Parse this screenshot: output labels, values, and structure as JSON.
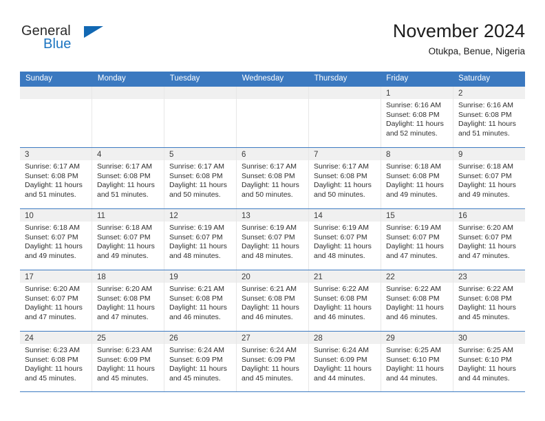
{
  "brand": {
    "word1": "General",
    "word2": "Blue",
    "accent_color": "#1268b3"
  },
  "header": {
    "title": "November 2024",
    "location": "Otukpa, Benue, Nigeria"
  },
  "theme": {
    "header_bar": "#3b79c0",
    "day_number_band": "#f0f0f0",
    "cell_divider": "#e7e7e7"
  },
  "weekday_headers": [
    "Sunday",
    "Monday",
    "Tuesday",
    "Wednesday",
    "Thursday",
    "Friday",
    "Saturday"
  ],
  "weeks": [
    [
      {
        "day": "",
        "sunrise": "",
        "sunset": "",
        "daylight1": "",
        "daylight2": ""
      },
      {
        "day": "",
        "sunrise": "",
        "sunset": "",
        "daylight1": "",
        "daylight2": ""
      },
      {
        "day": "",
        "sunrise": "",
        "sunset": "",
        "daylight1": "",
        "daylight2": ""
      },
      {
        "day": "",
        "sunrise": "",
        "sunset": "",
        "daylight1": "",
        "daylight2": ""
      },
      {
        "day": "",
        "sunrise": "",
        "sunset": "",
        "daylight1": "",
        "daylight2": ""
      },
      {
        "day": "1",
        "sunrise": "Sunrise: 6:16 AM",
        "sunset": "Sunset: 6:08 PM",
        "daylight1": "Daylight: 11 hours",
        "daylight2": "and 52 minutes."
      },
      {
        "day": "2",
        "sunrise": "Sunrise: 6:16 AM",
        "sunset": "Sunset: 6:08 PM",
        "daylight1": "Daylight: 11 hours",
        "daylight2": "and 51 minutes."
      }
    ],
    [
      {
        "day": "3",
        "sunrise": "Sunrise: 6:17 AM",
        "sunset": "Sunset: 6:08 PM",
        "daylight1": "Daylight: 11 hours",
        "daylight2": "and 51 minutes."
      },
      {
        "day": "4",
        "sunrise": "Sunrise: 6:17 AM",
        "sunset": "Sunset: 6:08 PM",
        "daylight1": "Daylight: 11 hours",
        "daylight2": "and 51 minutes."
      },
      {
        "day": "5",
        "sunrise": "Sunrise: 6:17 AM",
        "sunset": "Sunset: 6:08 PM",
        "daylight1": "Daylight: 11 hours",
        "daylight2": "and 50 minutes."
      },
      {
        "day": "6",
        "sunrise": "Sunrise: 6:17 AM",
        "sunset": "Sunset: 6:08 PM",
        "daylight1": "Daylight: 11 hours",
        "daylight2": "and 50 minutes."
      },
      {
        "day": "7",
        "sunrise": "Sunrise: 6:17 AM",
        "sunset": "Sunset: 6:08 PM",
        "daylight1": "Daylight: 11 hours",
        "daylight2": "and 50 minutes."
      },
      {
        "day": "8",
        "sunrise": "Sunrise: 6:18 AM",
        "sunset": "Sunset: 6:08 PM",
        "daylight1": "Daylight: 11 hours",
        "daylight2": "and 49 minutes."
      },
      {
        "day": "9",
        "sunrise": "Sunrise: 6:18 AM",
        "sunset": "Sunset: 6:07 PM",
        "daylight1": "Daylight: 11 hours",
        "daylight2": "and 49 minutes."
      }
    ],
    [
      {
        "day": "10",
        "sunrise": "Sunrise: 6:18 AM",
        "sunset": "Sunset: 6:07 PM",
        "daylight1": "Daylight: 11 hours",
        "daylight2": "and 49 minutes."
      },
      {
        "day": "11",
        "sunrise": "Sunrise: 6:18 AM",
        "sunset": "Sunset: 6:07 PM",
        "daylight1": "Daylight: 11 hours",
        "daylight2": "and 49 minutes."
      },
      {
        "day": "12",
        "sunrise": "Sunrise: 6:19 AM",
        "sunset": "Sunset: 6:07 PM",
        "daylight1": "Daylight: 11 hours",
        "daylight2": "and 48 minutes."
      },
      {
        "day": "13",
        "sunrise": "Sunrise: 6:19 AM",
        "sunset": "Sunset: 6:07 PM",
        "daylight1": "Daylight: 11 hours",
        "daylight2": "and 48 minutes."
      },
      {
        "day": "14",
        "sunrise": "Sunrise: 6:19 AM",
        "sunset": "Sunset: 6:07 PM",
        "daylight1": "Daylight: 11 hours",
        "daylight2": "and 48 minutes."
      },
      {
        "day": "15",
        "sunrise": "Sunrise: 6:19 AM",
        "sunset": "Sunset: 6:07 PM",
        "daylight1": "Daylight: 11 hours",
        "daylight2": "and 47 minutes."
      },
      {
        "day": "16",
        "sunrise": "Sunrise: 6:20 AM",
        "sunset": "Sunset: 6:07 PM",
        "daylight1": "Daylight: 11 hours",
        "daylight2": "and 47 minutes."
      }
    ],
    [
      {
        "day": "17",
        "sunrise": "Sunrise: 6:20 AM",
        "sunset": "Sunset: 6:07 PM",
        "daylight1": "Daylight: 11 hours",
        "daylight2": "and 47 minutes."
      },
      {
        "day": "18",
        "sunrise": "Sunrise: 6:20 AM",
        "sunset": "Sunset: 6:08 PM",
        "daylight1": "Daylight: 11 hours",
        "daylight2": "and 47 minutes."
      },
      {
        "day": "19",
        "sunrise": "Sunrise: 6:21 AM",
        "sunset": "Sunset: 6:08 PM",
        "daylight1": "Daylight: 11 hours",
        "daylight2": "and 46 minutes."
      },
      {
        "day": "20",
        "sunrise": "Sunrise: 6:21 AM",
        "sunset": "Sunset: 6:08 PM",
        "daylight1": "Daylight: 11 hours",
        "daylight2": "and 46 minutes."
      },
      {
        "day": "21",
        "sunrise": "Sunrise: 6:22 AM",
        "sunset": "Sunset: 6:08 PM",
        "daylight1": "Daylight: 11 hours",
        "daylight2": "and 46 minutes."
      },
      {
        "day": "22",
        "sunrise": "Sunrise: 6:22 AM",
        "sunset": "Sunset: 6:08 PM",
        "daylight1": "Daylight: 11 hours",
        "daylight2": "and 46 minutes."
      },
      {
        "day": "23",
        "sunrise": "Sunrise: 6:22 AM",
        "sunset": "Sunset: 6:08 PM",
        "daylight1": "Daylight: 11 hours",
        "daylight2": "and 45 minutes."
      }
    ],
    [
      {
        "day": "24",
        "sunrise": "Sunrise: 6:23 AM",
        "sunset": "Sunset: 6:08 PM",
        "daylight1": "Daylight: 11 hours",
        "daylight2": "and 45 minutes."
      },
      {
        "day": "25",
        "sunrise": "Sunrise: 6:23 AM",
        "sunset": "Sunset: 6:09 PM",
        "daylight1": "Daylight: 11 hours",
        "daylight2": "and 45 minutes."
      },
      {
        "day": "26",
        "sunrise": "Sunrise: 6:24 AM",
        "sunset": "Sunset: 6:09 PM",
        "daylight1": "Daylight: 11 hours",
        "daylight2": "and 45 minutes."
      },
      {
        "day": "27",
        "sunrise": "Sunrise: 6:24 AM",
        "sunset": "Sunset: 6:09 PM",
        "daylight1": "Daylight: 11 hours",
        "daylight2": "and 45 minutes."
      },
      {
        "day": "28",
        "sunrise": "Sunrise: 6:24 AM",
        "sunset": "Sunset: 6:09 PM",
        "daylight1": "Daylight: 11 hours",
        "daylight2": "and 44 minutes."
      },
      {
        "day": "29",
        "sunrise": "Sunrise: 6:25 AM",
        "sunset": "Sunset: 6:10 PM",
        "daylight1": "Daylight: 11 hours",
        "daylight2": "and 44 minutes."
      },
      {
        "day": "30",
        "sunrise": "Sunrise: 6:25 AM",
        "sunset": "Sunset: 6:10 PM",
        "daylight1": "Daylight: 11 hours",
        "daylight2": "and 44 minutes."
      }
    ]
  ]
}
